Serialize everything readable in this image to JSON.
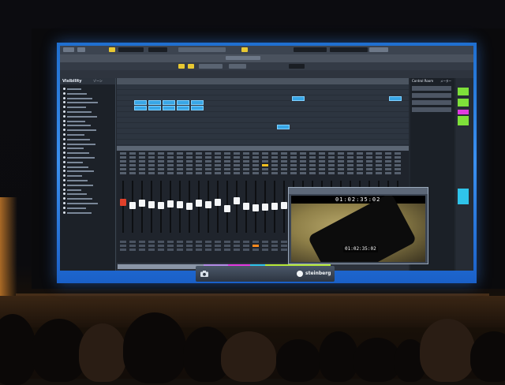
{
  "colors": {
    "desktop_blue": "#2f82e6",
    "event_blue": "#38a6e6",
    "selected_channel": "#f0c020",
    "record_red": "#e0402a",
    "monitor_orange": "#ff8a1e",
    "green_indicator": "#7ee03a",
    "magenta_indicator": "#e23ae0",
    "cyan_indicator": "#2fc4ea"
  },
  "visibility_panel": {
    "tab_label": "Visibility",
    "zone_tab_label": "ゾーン"
  },
  "mixer": {
    "channel_count": 30,
    "selected_channel_index": 15,
    "record_channel_index": 0,
    "fader_levels": [
      0.45,
      0.38,
      0.42,
      0.4,
      0.37,
      0.41,
      0.39,
      0.36,
      0.43,
      0.4,
      0.44,
      0.3,
      0.48,
      0.35,
      0.33,
      0.34,
      0.36,
      0.38,
      0.45,
      0.42,
      0.44,
      0.43,
      0.46,
      0.42,
      0.45,
      0.41,
      0.43,
      0.47,
      0.44,
      0.46
    ]
  },
  "control_room": {
    "title": "Control Room",
    "meter_label": "メーター"
  },
  "video": {
    "timecode_top": "01:02:35:02",
    "timecode_bottom": "01:02:35:02"
  },
  "taskbar": {
    "brand": "steinberg",
    "camera_icon": "camera-icon"
  }
}
